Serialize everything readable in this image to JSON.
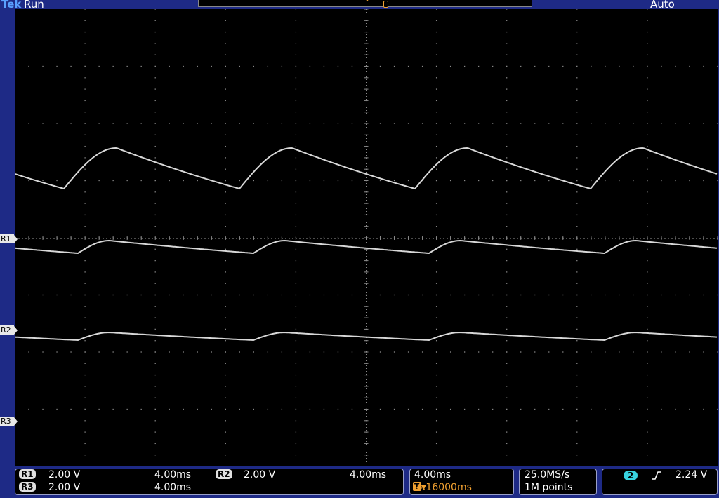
{
  "header": {
    "brand": "Tek",
    "run_state": "Run",
    "acquisition_mode": "Auto"
  },
  "markers": {
    "trigger_label": "T"
  },
  "ref_labels": [
    "R1",
    "R2",
    "R3"
  ],
  "channels": {
    "r1": {
      "label": "R1",
      "volts_div": "2.00 V",
      "time_div": "4.00ms"
    },
    "r2": {
      "label": "R2",
      "volts_div": "2.00 V",
      "time_div": "4.00ms"
    },
    "r3": {
      "label": "R3",
      "volts_div": "2.00 V",
      "time_div": "4.00ms"
    }
  },
  "horizontal": {
    "scale": "4.00ms",
    "trigger_position": "-4.16000ms"
  },
  "acquisition": {
    "sample_rate": "25.0MS/s",
    "record_length": "1M points"
  },
  "trigger": {
    "source": "2",
    "slope_icon": "rising-edge-icon",
    "level": "2.24 V"
  },
  "colors": {
    "screen_background": "#000000",
    "frame": "#1e2a86",
    "trace": "#d8d8d8",
    "trigger_accent": "#f0a030",
    "trigger_source": "#38d3e0"
  }
}
